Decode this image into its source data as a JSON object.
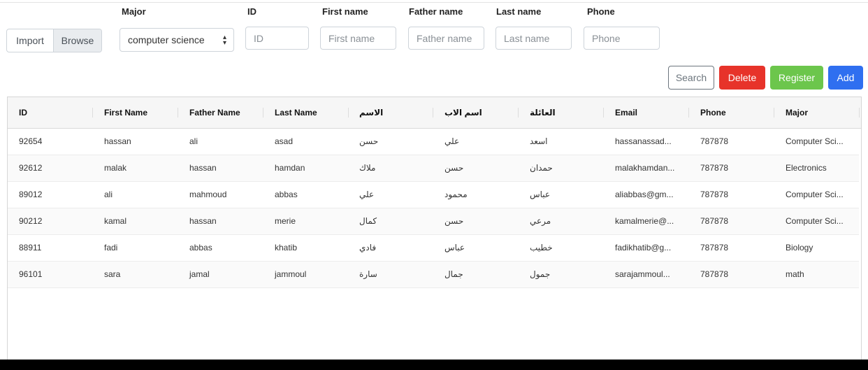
{
  "filters": {
    "file": {
      "import_label": "Import",
      "browse_label": "Browse"
    },
    "major": {
      "label": "Major",
      "value": "computer science"
    },
    "id": {
      "label": "ID",
      "placeholder": "ID"
    },
    "first_name": {
      "label": "First name",
      "placeholder": "First name"
    },
    "father_name": {
      "label": "Father name",
      "placeholder": "Father name"
    },
    "last_name": {
      "label": "Last name",
      "placeholder": "Last name"
    },
    "phone": {
      "label": "Phone",
      "placeholder": "Phone"
    }
  },
  "actions": {
    "search": "Search",
    "delete": "Delete",
    "register": "Register",
    "add": "Add"
  },
  "colors": {
    "delete": "#e7332a",
    "register": "#6cc64c",
    "add": "#2f6ff0"
  },
  "table": {
    "columns": [
      "ID",
      "First Name",
      "Father Name",
      "Last Name",
      "الاسم",
      "اسم الاب",
      "العائلة",
      "Email",
      "Phone",
      "Major"
    ],
    "rows": [
      [
        "92654",
        "hassan",
        "ali",
        "asad",
        "حسن",
        "علي",
        "اسعد",
        "hassanassad...",
        "787878",
        "Computer Sci..."
      ],
      [
        "92612",
        "malak",
        "hassan",
        "hamdan",
        "ملاك",
        "حسن",
        "حمدان",
        "malakhamdan...",
        "787878",
        "Electronics"
      ],
      [
        "89012",
        "ali",
        "mahmoud",
        "abbas",
        "علي",
        "محمود",
        "عباس",
        "aliabbas@gm...",
        "787878",
        "Computer Sci..."
      ],
      [
        "90212",
        "kamal",
        "hassan",
        "merie",
        "كمال",
        "حسن",
        "مرعي",
        "kamalmerie@...",
        "787878",
        "Computer Sci..."
      ],
      [
        "88911",
        "fadi",
        "abbas",
        "khatib",
        "فادي",
        "عباس",
        "خطيب",
        "fadikhatib@g...",
        "787878",
        "Biology"
      ],
      [
        "96101",
        "sara",
        "jamal",
        "jammoul",
        "سارة",
        "جمال",
        "جمول",
        "sarajammoul...",
        "787878",
        "math"
      ]
    ]
  }
}
